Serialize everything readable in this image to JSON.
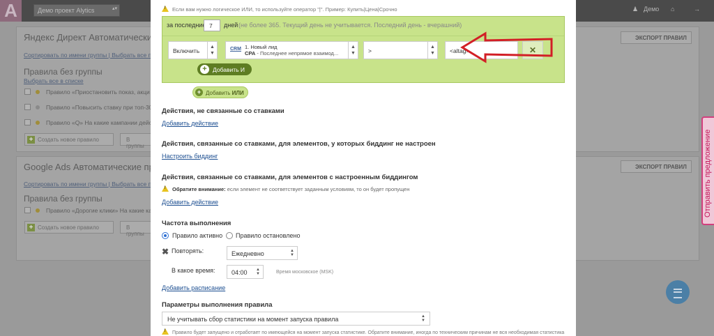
{
  "background": {
    "logo": "A",
    "project_select": "Демо проект Alytics",
    "user_label": "Демо",
    "panel1_title": "Яндекс Директ Автоматические прави",
    "panel1_sort": "Сортировать по имени группы | Выбрать все прав",
    "group_title": "Правила без группы",
    "select_all": "Выбрать все в списке",
    "panel1_rows": [
      "Правило «Приостановить показ, акци",
      "Правило «Повысить ставку при топ-30» Н",
      "Правило «Q» На какие кампании действия"
    ],
    "btn_create": "Создать новое правило",
    "btn_other": "В группы",
    "export_label": "ЭКСПОРТ ПРАВИЛ",
    "panel2_title": "Google Ads Автоматические правила",
    "panel2_sort": "Сортировать по имени группы | Выбрать все пра",
    "panel2_rows": [
      "Правило «Дорогие клики» На какие кампа"
    ],
    "btn_create2": "Создать новое правило",
    "btn_other2": "В группы"
  },
  "side_tab": {
    "label": "Отправить предложение"
  },
  "modal": {
    "hint_top": "Если вам нужно логическое ИЛИ, то используйте оператор \"|\". Пример: Купить|Цена|Срочно",
    "period_label": "за последние",
    "days_value": "7",
    "days_label": "дней",
    "days_hint": "(не более 365. Текущий день не учитывается. Последний день - вчерашний)",
    "condition": {
      "mode": "Включить",
      "metric_icon": "CRM",
      "metric_line1": "1. Новый лид",
      "metric_line2_bold": "CPA",
      "metric_line2": " - Последнее непрямое взаимод...",
      "operator": ">",
      "value": "<altag>",
      "delete_label": "✕"
    },
    "add_and": "Добавить И",
    "add_or_prefix": "Добавить",
    "add_or_bold": "ИЛИ",
    "section1_title": "Действия, не связанные со ставками",
    "section1_link": "Добавить действие",
    "section2_title": "Действия, связанные со ставками, для элементов, у которых биддинг не настроен",
    "section2_link": "Настроить биддинг",
    "section3_title": "Действия, связанные со ставками, для элементов с настроенным биддингом",
    "section3_warn_bold": "Обратите внимание:",
    "section3_warn": " если элемент не соответствует заданным условиям, то он будет пропущен",
    "section3_link": "Добавить действие",
    "freq_title": "Частота выполнения",
    "radio_active": "Правило активно",
    "radio_stopped": "Правило остановлено",
    "repeat_label": "Повторять:",
    "repeat_value": "Ежедневно",
    "time_label": "В какое время:",
    "time_value": "04:00",
    "time_zone": "Время московское (MSK)",
    "add_schedule": "Добавить расписание",
    "params_title": "Параметры выполнения правила",
    "params_value": "Не учитывать сбор статистики на момент запуска правила",
    "bottom_note": "Правило будет запущено и отработает по имеющейся на момент запуска статистике. Обратите внимание, иногда по техническим причинам не вся необходимая статистика"
  },
  "colors": {
    "condition_bg": "#c8e38a",
    "add_and_bg": "#5e7d22",
    "link": "#1d4f91",
    "annotation_arrow": "#d21f26"
  }
}
